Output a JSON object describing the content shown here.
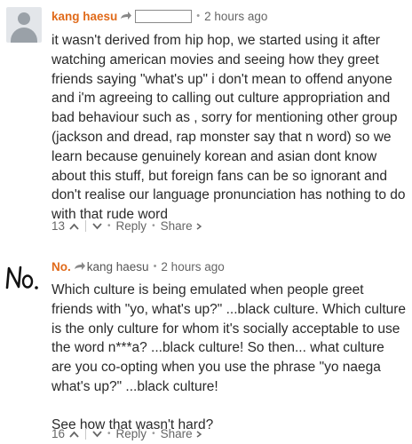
{
  "comments": [
    {
      "author": "kang haesu",
      "reply_to": "",
      "time": "2 hours ago",
      "paragraphs": [
        "it wasn't derived from hip hop, we started using it after watching american movies and seeing how they greet friends saying \"what's up\" i don't mean to offend anyone and i'm agreeing to calling out culture appropriation and bad behaviour such as , sorry for mentioning other group (jackson and dread, rap monster say that n word) so we learn because genuinely korean and asian dont know about this stuff, but foreign fans can be so ignorant and don't realise our language pronunciation has nothing to do with that rude word"
      ],
      "votes": "13",
      "reply_label": "Reply",
      "share_label": "Share"
    },
    {
      "author": "No.",
      "reply_to": "kang haesu",
      "time": "2 hours ago",
      "avatar_text": "No.",
      "paragraphs": [
        "Which culture is being emulated when people greet friends with \"yo, what's up?\" ...black culture. Which culture is the only culture for whom it's socially acceptable to use the word n***a? ...black culture! So then... what culture are you co-opting when you use the phrase \"yo naega what's up?\" ...black culture!",
        "See how that wasn't hard?"
      ],
      "votes": "16",
      "reply_label": "Reply",
      "share_label": "Share"
    }
  ],
  "colors": {
    "author": "#e06a1a",
    "meta": "#666666",
    "body_text": "#2a2a2a"
  },
  "icons": [
    "default-avatar-icon",
    "reply-arrow-icon",
    "upvote-icon",
    "downvote-icon",
    "share-arrow-icon"
  ]
}
